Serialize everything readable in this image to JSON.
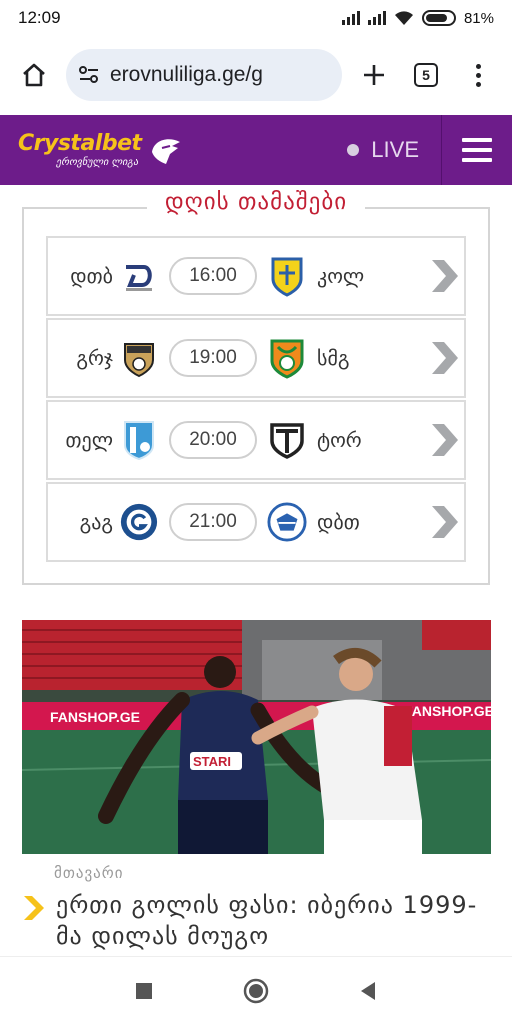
{
  "status": {
    "time": "12:09",
    "battery": "81%"
  },
  "browser": {
    "url": "erovnuliliga.ge/g",
    "tabs_count": "5"
  },
  "site": {
    "logo_main": "Crystalbet",
    "logo_sub": "ეროვნული ლიგა",
    "live_label": "LIVE",
    "brand_color": "#6d1c8a"
  },
  "games": {
    "title": "დღის თამაშები",
    "matches": [
      {
        "home": "დთბ",
        "time": "16:00",
        "away": "კოლ"
      },
      {
        "home": "გრჯ",
        "time": "19:00",
        "away": "სმგ"
      },
      {
        "home": "თელ",
        "time": "20:00",
        "away": "ტორ"
      },
      {
        "home": "გაგ",
        "time": "21:00",
        "away": "დბთ"
      }
    ]
  },
  "article": {
    "category": "მთავარი",
    "headline": "ერთი გოლის ფასი: იბერია 1999-მა დილას მოუგო",
    "photo_ad_text": "FANSHOP.GE",
    "photo_shirt_text": "STARI"
  }
}
